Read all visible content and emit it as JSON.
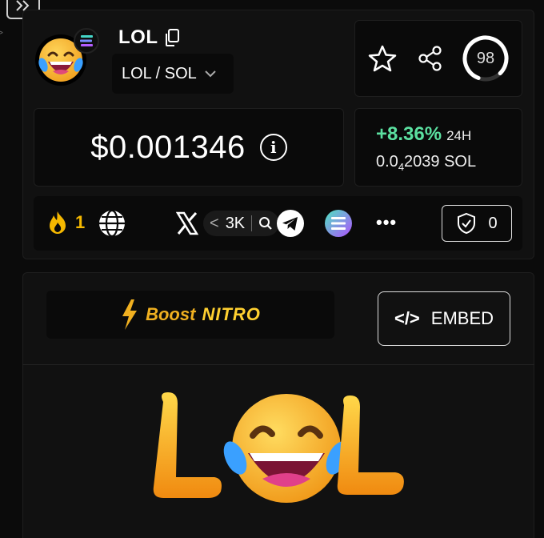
{
  "nav": {
    "collapse_icon": "double-chevron-right-icon",
    "side_mark": ">"
  },
  "token": {
    "name": "LOL",
    "pair": "LOL / SOL",
    "avatar_icon": "laughing-emoji-icon",
    "chain_icon": "solana-icon"
  },
  "actions": {
    "score": "98",
    "score_fraction": 0.82
  },
  "price": {
    "value": "$0.001346",
    "info_glyph": "i"
  },
  "change": {
    "pct": "+8.36%",
    "period": "24H",
    "sol_prefix": "0.0",
    "sol_sub": "4",
    "sol_rest": "2039 SOL"
  },
  "social": {
    "hot_count": "1",
    "x_followers": "3K",
    "x_arrow": "<",
    "more": "•••",
    "shield_count": "0"
  },
  "boost": {
    "boost": "Boost",
    "nitro": "NITRO"
  },
  "embed": {
    "label": "EMBED",
    "icon_text": "</>"
  },
  "colors": {
    "accent_green": "#5be0a0",
    "boost_gold": "#f0b020",
    "background": "#0b0b0b"
  }
}
